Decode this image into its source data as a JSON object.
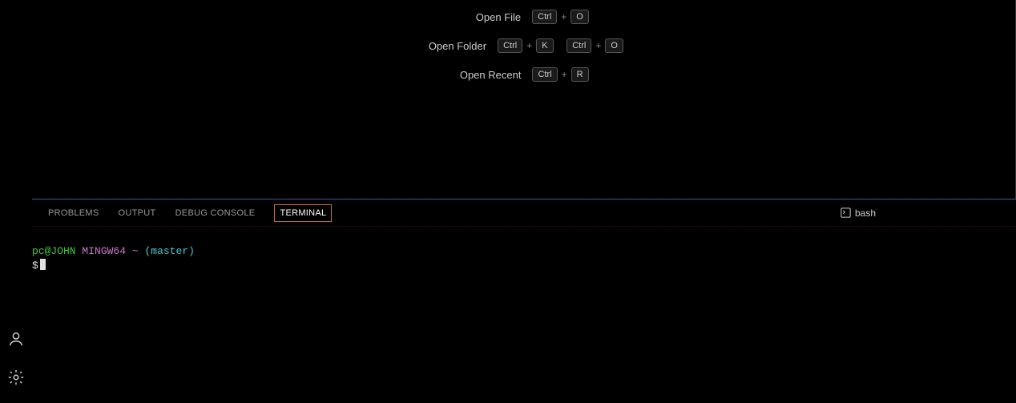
{
  "welcome": {
    "shortcuts": [
      {
        "label": "Open File",
        "keys": [
          [
            "Ctrl",
            "O"
          ]
        ]
      },
      {
        "label": "Open Folder",
        "keys": [
          [
            "Ctrl",
            "K"
          ],
          [
            "Ctrl",
            "O"
          ]
        ]
      },
      {
        "label": "Open Recent",
        "keys": [
          [
            "Ctrl",
            "R"
          ]
        ]
      }
    ]
  },
  "panel": {
    "tabs": [
      {
        "id": "problems",
        "label": "PROBLEMS",
        "active": false
      },
      {
        "id": "output",
        "label": "OUTPUT",
        "active": false
      },
      {
        "id": "debug-console",
        "label": "DEBUG CONSOLE",
        "active": false
      },
      {
        "id": "terminal",
        "label": "TERMINAL",
        "active": true
      }
    ],
    "terminal_name": "bash"
  },
  "terminal": {
    "prompt_user": "pc@JOHN",
    "prompt_env": "MINGW64",
    "prompt_path": "~",
    "prompt_branch": "(master)",
    "prompt_symbol": "$"
  }
}
